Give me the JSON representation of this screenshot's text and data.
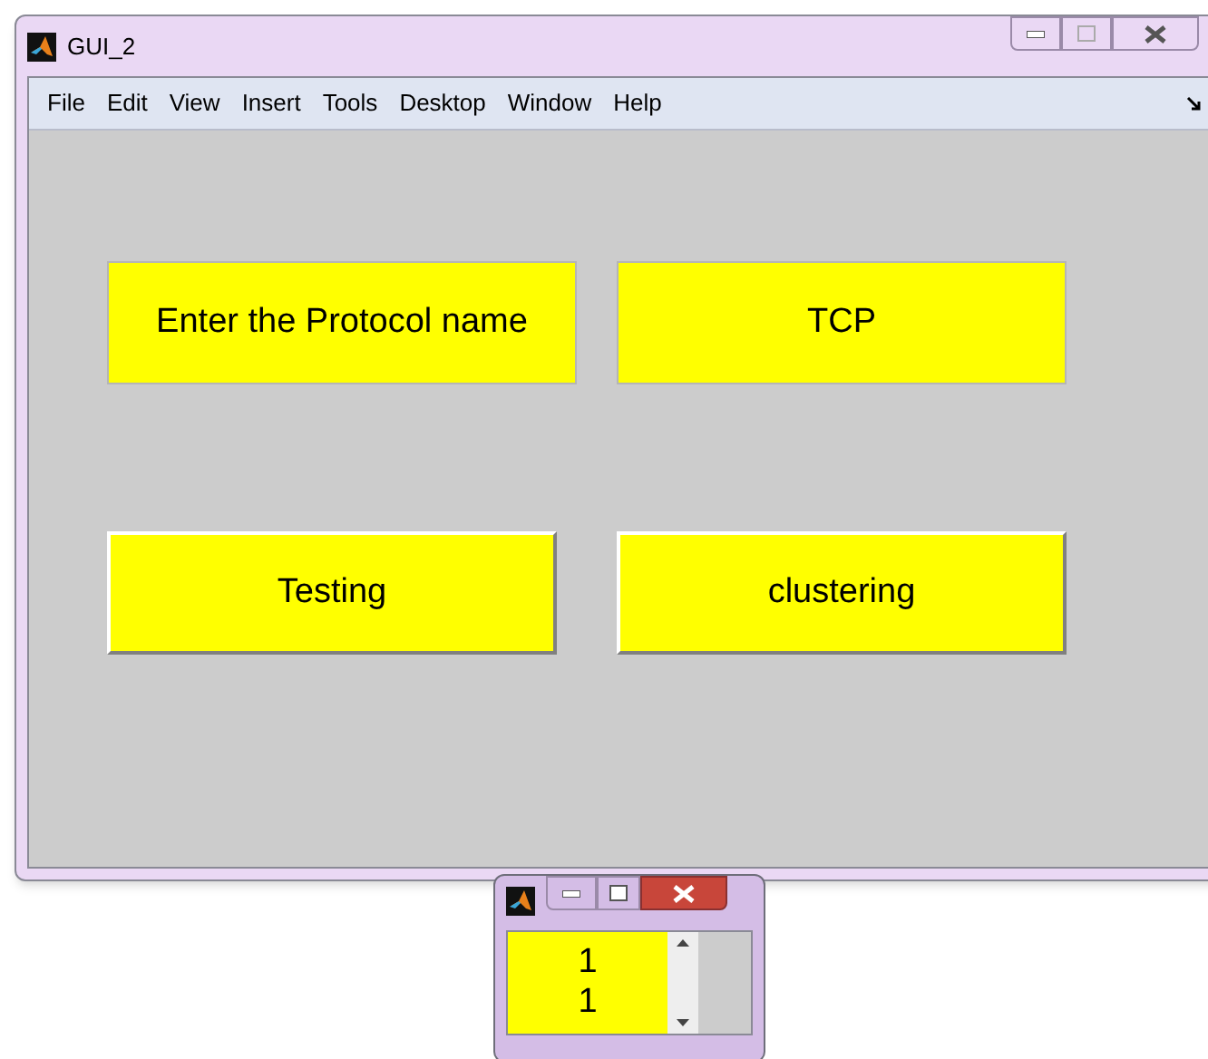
{
  "window": {
    "title": "GUI_2"
  },
  "menu": [
    "File",
    "Edit",
    "View",
    "Insert",
    "Tools",
    "Desktop",
    "Window",
    "Help"
  ],
  "controls": [
    {
      "kind": "label",
      "text": "Enter the Protocol name"
    },
    {
      "kind": "field",
      "text": "TCP"
    },
    {
      "kind": "button",
      "text": "Testing"
    },
    {
      "kind": "button",
      "text": "clustering"
    }
  ],
  "small_window": {
    "list_items": [
      "1",
      "1"
    ]
  }
}
